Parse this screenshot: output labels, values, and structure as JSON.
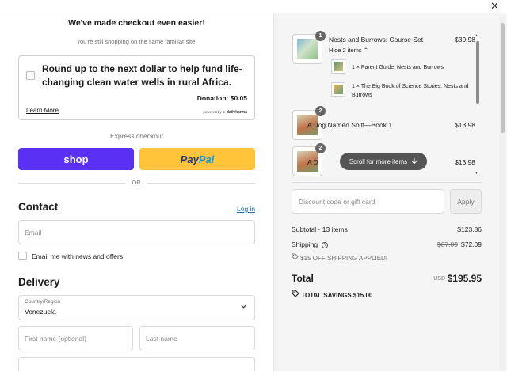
{
  "left": {
    "title": "We've made checkout even easier!",
    "subtitle": "You're still shopping on the same familiar site.",
    "roundup": {
      "text": "Round up to the next dollar to help fund life-changing clean water wells in rural Africa.",
      "donation": "Donation: $0.05",
      "learn_more": "Learn More",
      "powered_by": "powered by",
      "brand": "dailykarma"
    },
    "express_checkout": "Express checkout",
    "shop_label": "shop",
    "paypal_pay": "Pay",
    "paypal_pal": "Pal",
    "or": "OR",
    "contact": {
      "heading": "Contact",
      "login": "Log in",
      "email_placeholder": "Email",
      "news_label": "Email me with news and offers"
    },
    "delivery": {
      "heading": "Delivery",
      "country_label": "Country/Region",
      "country_value": "Venezuela",
      "first_name_placeholder": "First name (optional)",
      "last_name_placeholder": "Last name"
    }
  },
  "cart": {
    "items": [
      {
        "name": "Nests and Burrows: Course Set",
        "price": "$39.98",
        "qty": "1",
        "hide_label": "Hide 2 items",
        "sub_items": [
          "1 × Parent Guide: Nests and Burrows",
          "1 × The Big Book of Science Stories: Nests and Burrows"
        ]
      },
      {
        "name": "A Dog Named Sniff—Book 1",
        "price": "$13.98",
        "qty": "2"
      },
      {
        "name": "A D",
        "price": "$13.98",
        "qty": "2"
      }
    ],
    "scroll_pill": "Scroll for more items",
    "discount_placeholder": "Discount code or gift card",
    "apply": "Apply",
    "subtotal_label": "Subtotal · 13 items",
    "subtotal_value": "$123.86",
    "shipping_label": "Shipping",
    "shipping_old": "$87.09",
    "shipping_new": "$72.09",
    "promo": "$15 OFF SHIPPING APPLIED!",
    "total_label": "Total",
    "currency": "USD",
    "total_value": "$195.95",
    "savings": "TOTAL SAVINGS  $15.00"
  },
  "colors": {
    "shop": "#5a31f4",
    "paypal": "#ffc439",
    "link": "#1773b0"
  }
}
